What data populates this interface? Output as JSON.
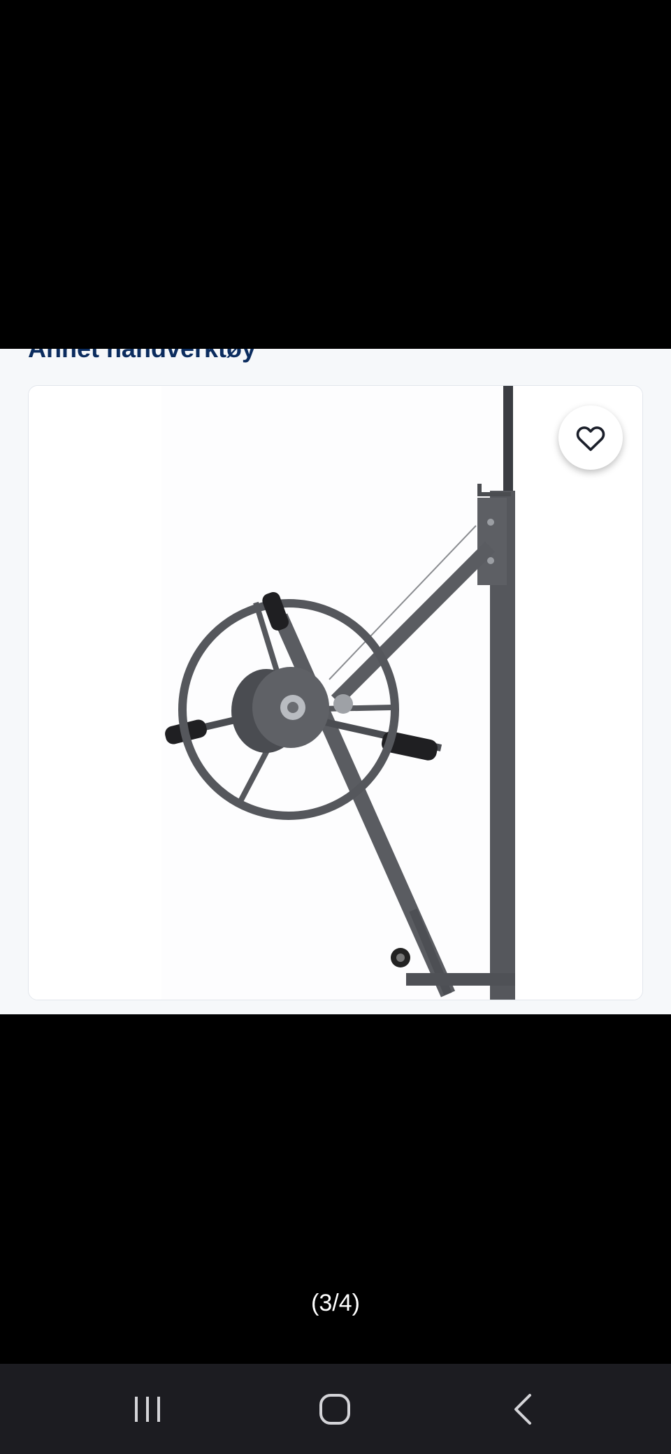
{
  "listing": {
    "category": "Annet håndverktøy"
  },
  "viewer": {
    "counter": "(3/4)"
  },
  "icons": {
    "favorite": "heart-outline-icon",
    "recents": "recent-apps-icon",
    "home": "home-icon",
    "back": "back-chevron-icon"
  },
  "colors": {
    "heading": "#0b2c5e",
    "panel_background": "#f6f8fa",
    "nav_bar": "#1c1c21"
  }
}
